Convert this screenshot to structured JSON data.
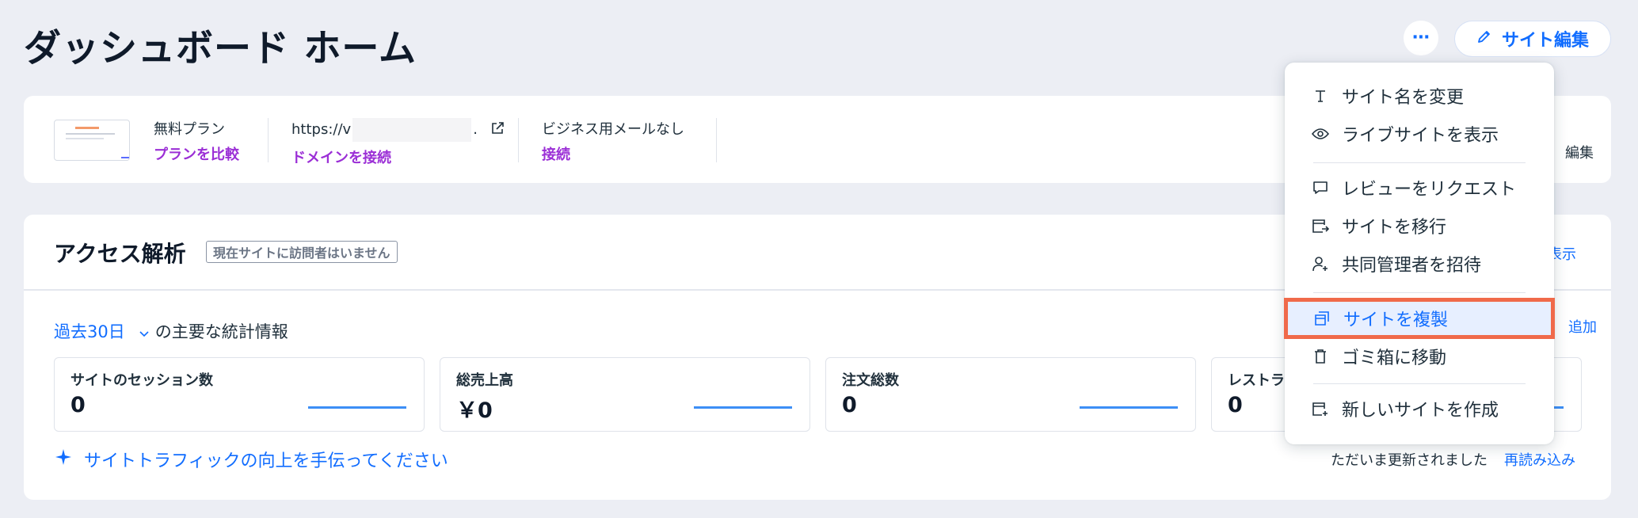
{
  "header": {
    "title": "ダッシュボード ホーム",
    "more_label": "⋯",
    "edit_site_label": "サイト編集"
  },
  "site_card": {
    "plan_label": "無料プラン",
    "plan_link": "プランを比較",
    "url_prefix": "https://v",
    "url_suffix": ".",
    "domain_link": "ドメインを接続",
    "email_label": "ビジネス用メールなし",
    "email_link": "接続",
    "edit_text": "編集"
  },
  "analytics": {
    "title": "アクセス解析",
    "badge": "現在サイトに訪問者はいません",
    "view_all": "表示",
    "period_selected": "過去30日",
    "period_suffix": "の主要な統計情報",
    "add_link": "追加",
    "stats": [
      {
        "label": "サイトのセッション数",
        "value": "0"
      },
      {
        "label": "総売上高",
        "value": "￥0"
      },
      {
        "label": "注文総数",
        "value": "0"
      },
      {
        "label": "レストラ",
        "value": "0"
      }
    ],
    "traffic_link": "サイトトラフィックの向上を手伝ってください",
    "updated_text": "ただいま更新されました",
    "reload_link": "再読み込み"
  },
  "menu": {
    "items": [
      {
        "label": "サイト名を変更",
        "icon": "text-icon"
      },
      {
        "label": "ライブサイトを表示",
        "icon": "eye-icon"
      },
      {
        "label": "レビューをリクエスト",
        "icon": "comment-icon"
      },
      {
        "label": "サイトを移行",
        "icon": "transfer-icon"
      },
      {
        "label": "共同管理者を招待",
        "icon": "invite-icon"
      },
      {
        "label": "サイトを複製",
        "icon": "duplicate-icon"
      },
      {
        "label": "ゴミ箱に移動",
        "icon": "trash-icon"
      },
      {
        "label": "新しいサイトを作成",
        "icon": "new-site-icon"
      }
    ]
  },
  "colors": {
    "accent": "#116dff",
    "purple_link": "#9b2fd6",
    "highlight_outline": "#f06a4a",
    "background": "#eceef4"
  }
}
